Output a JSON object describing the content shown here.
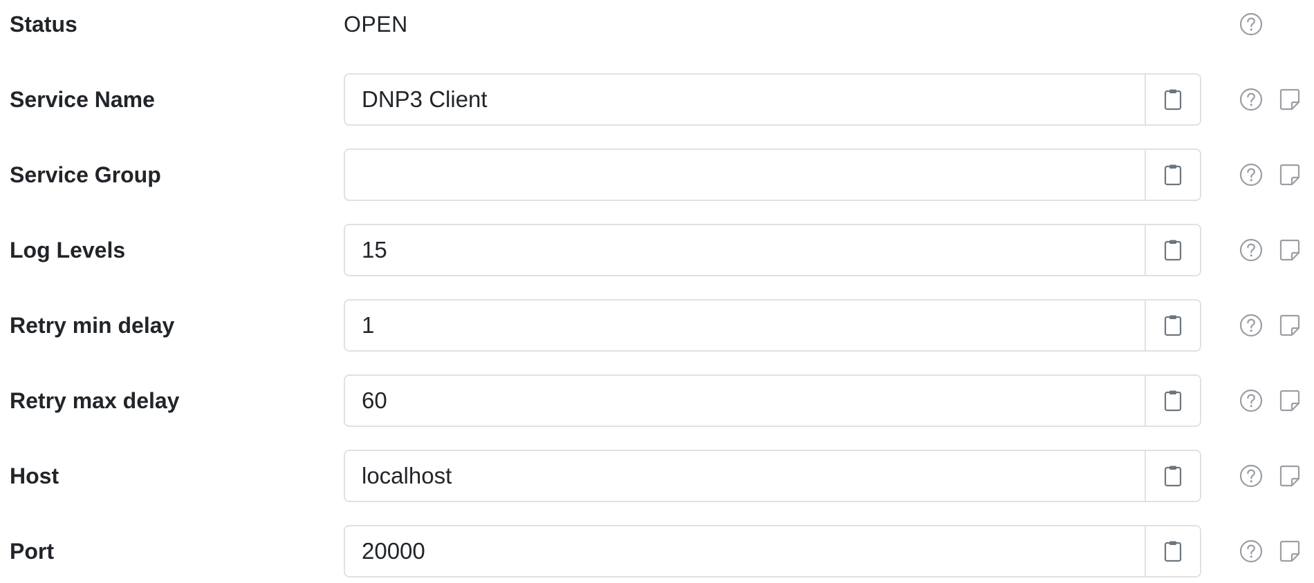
{
  "form": {
    "status": {
      "label": "Status",
      "value": "OPEN"
    },
    "fields": [
      {
        "id": "service-name",
        "label": "Service Name",
        "value": "DNP3 Client"
      },
      {
        "id": "service-group",
        "label": "Service Group",
        "value": ""
      },
      {
        "id": "log-levels",
        "label": "Log Levels",
        "value": "15"
      },
      {
        "id": "retry-min-delay",
        "label": "Retry min delay",
        "value": "1"
      },
      {
        "id": "retry-max-delay",
        "label": "Retry max delay",
        "value": "60"
      },
      {
        "id": "host",
        "label": "Host",
        "value": "localhost"
      },
      {
        "id": "port",
        "label": "Port",
        "value": "20000"
      }
    ]
  },
  "icons": {
    "help": "question-circle-icon",
    "copy": "clipboard-icon",
    "note": "sticky-note-icon"
  },
  "colors": {
    "text": "#212529",
    "border": "#dee2e6",
    "icon": "#9a9ea3"
  }
}
